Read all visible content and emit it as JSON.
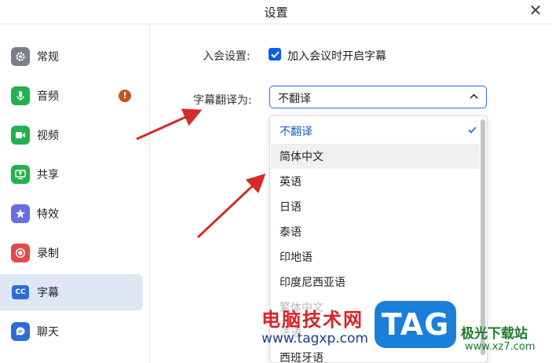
{
  "window": {
    "title": "设置",
    "close_glyph": "✕"
  },
  "sidebar": {
    "items": [
      {
        "label": "常规",
        "icon": "gear-icon",
        "color": "#7a7f8a",
        "active": false
      },
      {
        "label": "音频",
        "icon": "microphone-icon",
        "color": "#23b14d",
        "active": false,
        "badge": "!"
      },
      {
        "label": "视频",
        "icon": "video-camera-icon",
        "color": "#23b14d",
        "active": false
      },
      {
        "label": "共享",
        "icon": "share-screen-icon",
        "color": "#23b14d",
        "active": false
      },
      {
        "label": "特效",
        "icon": "effects-icon",
        "color": "#6a6de0",
        "active": false
      },
      {
        "label": "录制",
        "icon": "record-icon",
        "color": "#e34a4a",
        "active": false
      },
      {
        "label": "字幕",
        "icon": "cc-icon",
        "color": "#2d6bd9",
        "active": true
      },
      {
        "label": "聊天",
        "icon": "chat-icon",
        "color": "#2d6bd9",
        "active": false
      }
    ]
  },
  "settings": {
    "join_label": "入会设置:",
    "join_checkbox_label": "加入会议时开启字幕",
    "join_checked": true,
    "translate_label": "字幕翻译为:",
    "translate_value": "不翻译"
  },
  "dropdown": {
    "options": [
      {
        "label": "不翻译",
        "selected": true
      },
      {
        "label": "简体中文",
        "highlighted": true
      },
      {
        "label": "英语"
      },
      {
        "label": "日语"
      },
      {
        "label": "泰语"
      },
      {
        "label": "印地语"
      },
      {
        "label": "印度尼西亚语"
      },
      {
        "label": "繁体中文",
        "faded": true
      },
      {
        "label": "法语",
        "faded": true
      },
      {
        "label": "西班牙语"
      }
    ]
  },
  "watermark": {
    "text": "电脑技术网",
    "url": "www.tagxp.com",
    "logo": "TAG",
    "site": "极光下载站",
    "site_url": "www.xz7.com"
  },
  "colors": {
    "accent": "#2d6bd9",
    "arrow": "#d42a2a"
  }
}
